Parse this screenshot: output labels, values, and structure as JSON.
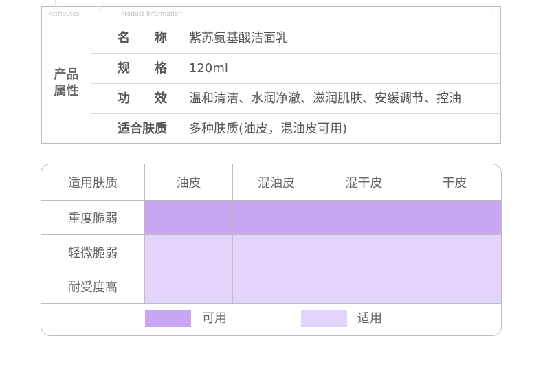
{
  "info": {
    "header_col1": "Attributes",
    "header_col2": "Product information",
    "side_label": "产品属性",
    "rows": [
      {
        "key": "名称",
        "value": "紫苏氨基酸洁面乳"
      },
      {
        "key": "规格",
        "value": "120ml"
      },
      {
        "key": "功效",
        "value": "温和清洁、水润净澈、滋润肌肤、安缓调节、控油"
      },
      {
        "key": "适合肤质",
        "value": "多种肤质(油皮，混油皮可用)"
      }
    ]
  },
  "skin": {
    "corner": "适用肤质",
    "columns": [
      "油皮",
      "混油皮",
      "混干皮",
      "干皮"
    ],
    "rows": [
      {
        "label": "重度脆弱",
        "levels": [
          "strong",
          "strong",
          "strong",
          "strong"
        ]
      },
      {
        "label": "轻微脆弱",
        "levels": [
          "light",
          "light",
          "light",
          "light"
        ]
      },
      {
        "label": "耐受度高",
        "levels": [
          "light",
          "light",
          "light",
          "light"
        ]
      }
    ],
    "legend": [
      {
        "label": "可用",
        "level": "strong",
        "color": "#c9a6f2"
      },
      {
        "label": "适用",
        "level": "light",
        "color": "#e2d4fb"
      }
    ]
  },
  "colors": {
    "strong": "#c9a6f2",
    "light": "#e2d4fb",
    "border": "#bdbdbd"
  }
}
